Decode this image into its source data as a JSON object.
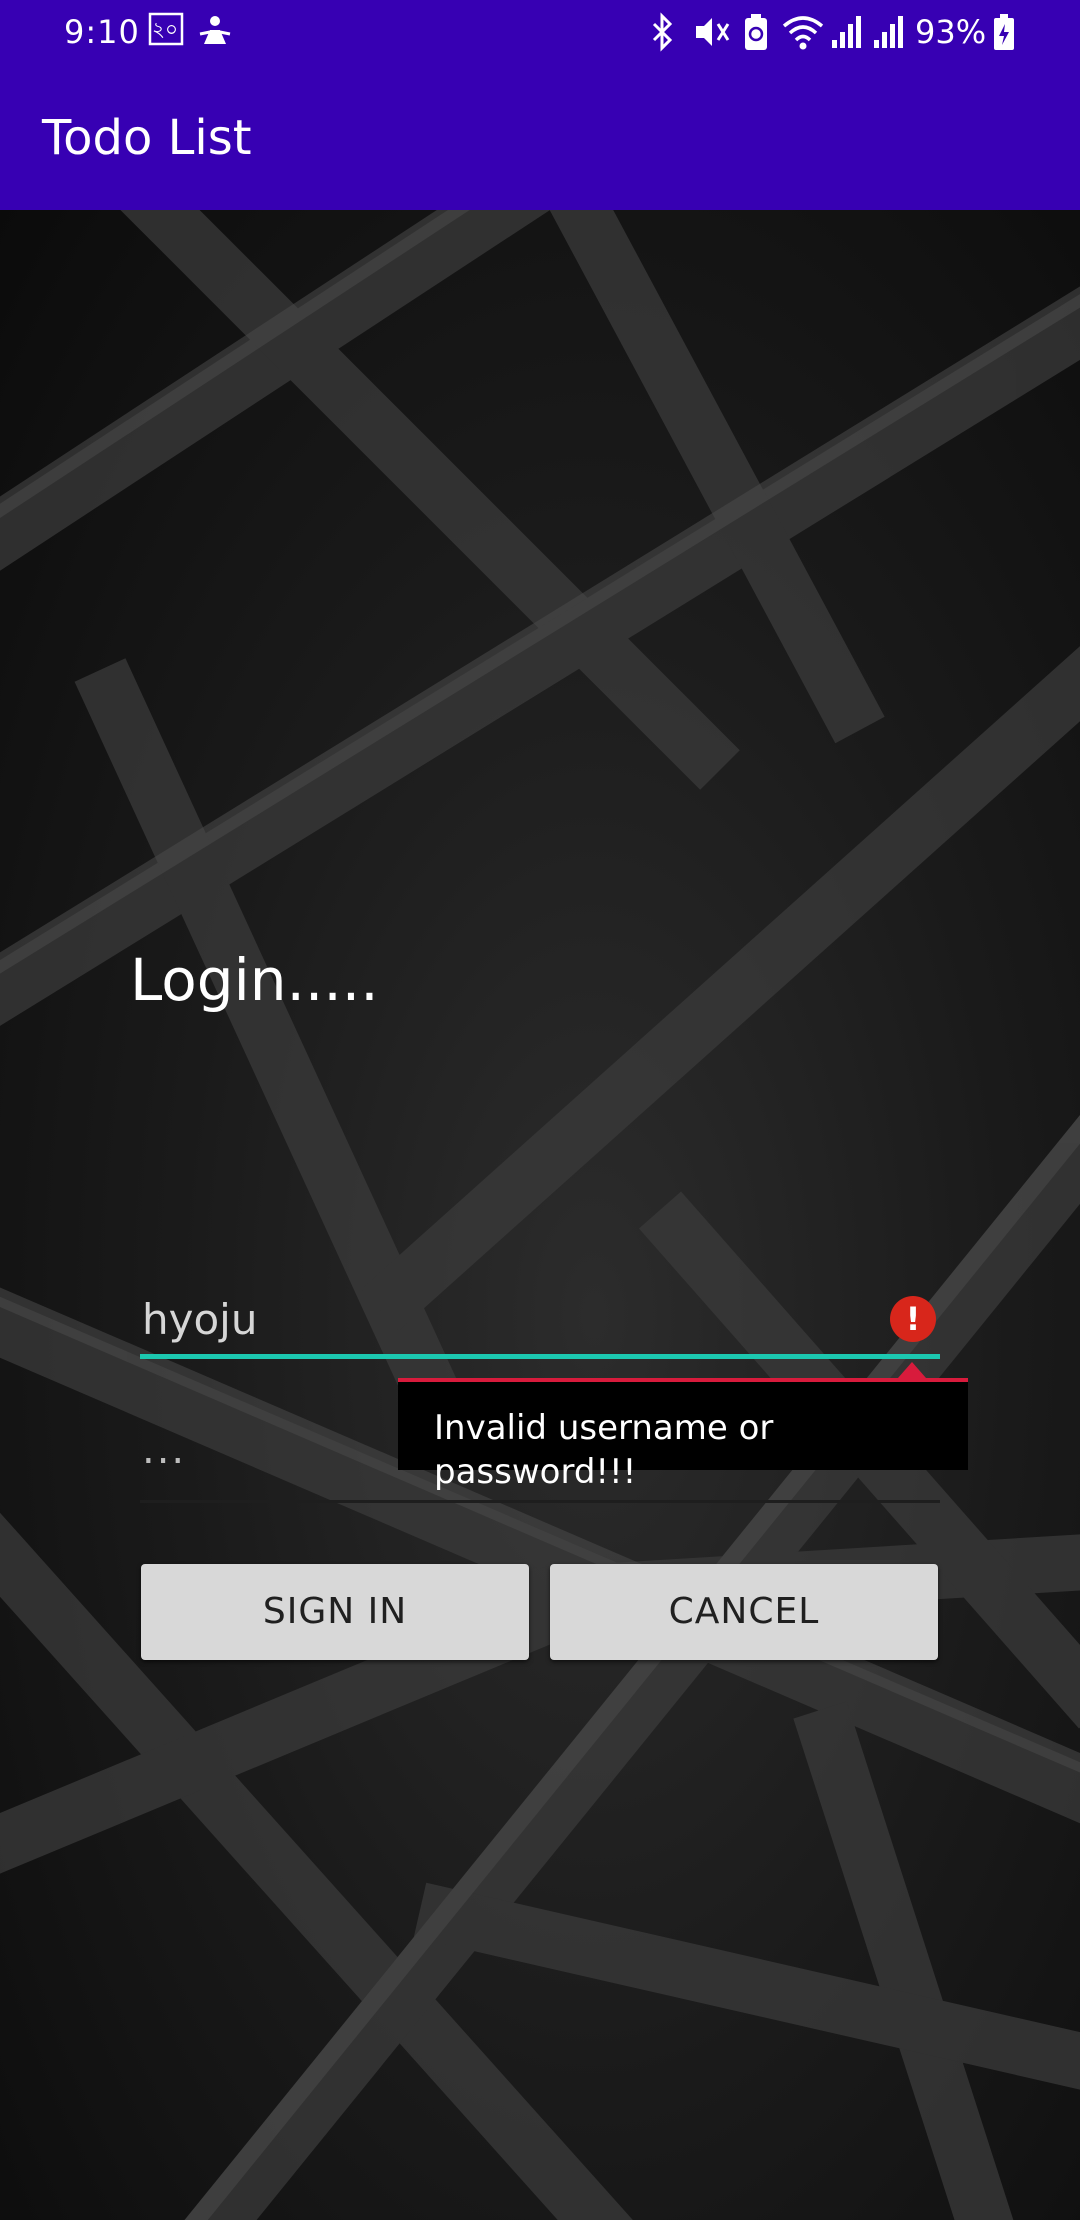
{
  "status_bar": {
    "time": "9:10",
    "notification_badge": "২০",
    "battery": "93%",
    "icons": [
      "notification-badge-icon",
      "assistant-icon",
      "bluetooth-icon",
      "mute-icon",
      "battery-saver-icon",
      "wifi-icon",
      "signal-icon",
      "signal-icon",
      "battery-icon"
    ]
  },
  "app_bar": {
    "title": "Todo List",
    "color": "#3700B3"
  },
  "login": {
    "heading": "Login.....",
    "username_value": "hyoju",
    "password_value": "...",
    "error_icon": "error-icon",
    "error_message": "Invalid username or password!!!",
    "signin_label": "SIGN IN",
    "cancel_label": "CANCEL"
  },
  "colors": {
    "accent_underline": "#1CC8B0",
    "error": "#D8261B",
    "popup_border": "#D81B3C",
    "button_bg": "#d8d8d8"
  }
}
